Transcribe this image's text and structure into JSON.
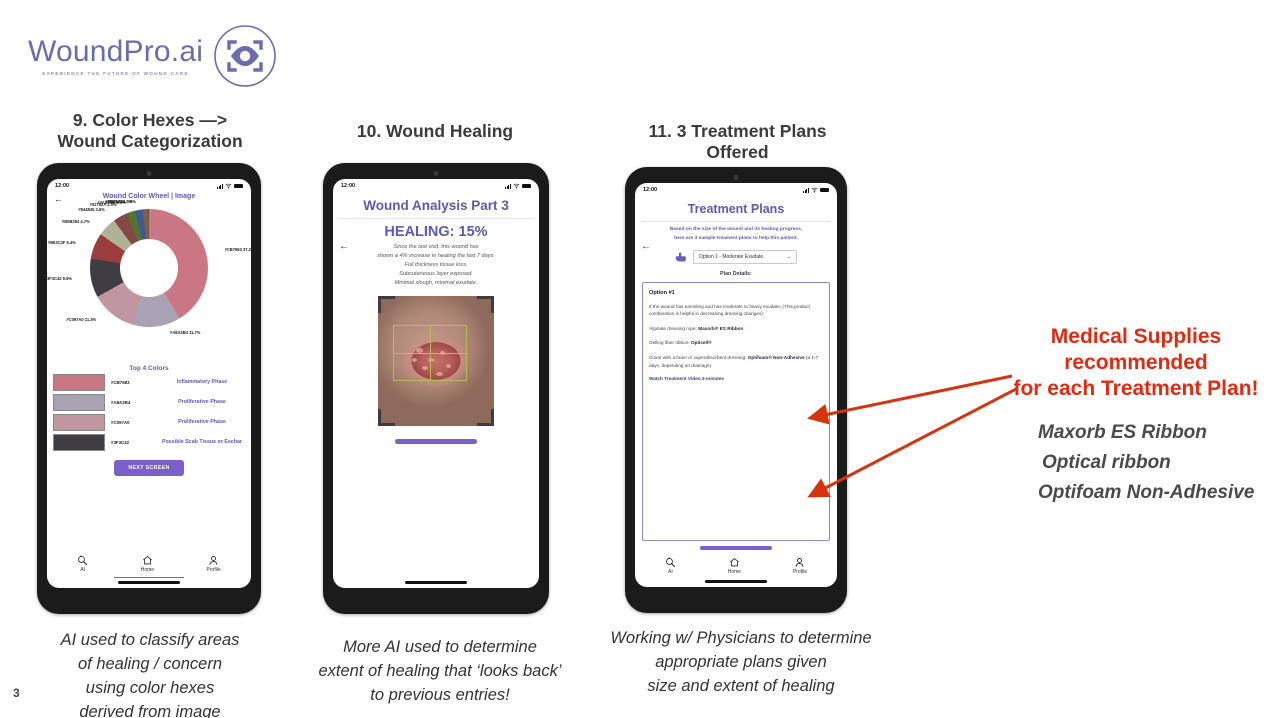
{
  "brand": {
    "name": "WoundPro.ai",
    "tagline": "EXPERIENCE THE FUTURE OF WOUND CARE",
    "logo_color": "#6b6bb0"
  },
  "sections": [
    {
      "title": "9. Color Hexes —>\nWound Categorization"
    },
    {
      "title": "10. Wound Healing"
    },
    {
      "title": "11. 3 Treatment Plans Offered"
    }
  ],
  "phone1": {
    "status": {
      "time": "12:00"
    },
    "app_title": "Wound Color Wheel | Image",
    "chart_title_top4": "Top 4 Colors",
    "next_button": "NEXT SCREEN",
    "nav": [
      {
        "label": "AI",
        "icon": "ai-search-icon"
      },
      {
        "label": "Home",
        "icon": "home-icon"
      },
      {
        "label": "Profile",
        "icon": "person-icon"
      }
    ],
    "top4": [
      {
        "hex": "#CB7683",
        "phase": "Inflammatory Phase"
      },
      {
        "hex": "#A8A2B4",
        "phase": "Proliferative Phase"
      },
      {
        "hex": "#C097A0",
        "phase": "Proliferative Phase"
      },
      {
        "hex": "#3F3C42",
        "phase": "Possible Scab Tissue or Eschar"
      }
    ]
  },
  "phone2": {
    "status": {
      "time": "12:00"
    },
    "title": "Wound Analysis Part 3",
    "healing_headline": "HEALING: 15%",
    "subtext": "Since the last visit, this wound has\nshown a 4% increase in healing the last 7 days.\nFull thickness tissue loss.\nSubcutaneous layer exposed.\nMinimal slough, minimal exudate."
  },
  "phone3": {
    "status": {
      "time": "12:00"
    },
    "title": "Treatment Plans",
    "description": "Based on the size of the wound and its healing progress,\nhere are 3 sample treament plans to help this patient.",
    "select_value": "Option 1 - Moderate Exudate",
    "plan_details_label": "Plan Details:",
    "plan": {
      "heading": "Option #1",
      "body": "If the wound has tunneling and has moderate to heavy exudate. (This product combination is helpful in decreasing dressing changes):",
      "line_alginate_prefix": "Alginate dressing rope: ",
      "line_alginate_product": "Maxorb® ES Ribbon",
      "line_gelling_prefix": "Gelling fiber ribbon: ",
      "line_gelling_product": "Opticell®",
      "line_cover_prefix": "Cover with a foam or superabsorbent dressing: ",
      "line_cover_product": "Optifoam® Non-Adhesive",
      "line_cover_suffix": " (a 1-7 days, depending on drainage)",
      "video_link": "Watch Treatment Video 3-minutes"
    },
    "nav": [
      {
        "label": "AI",
        "icon": "ai-search-icon"
      },
      {
        "label": "Home",
        "icon": "home-icon"
      },
      {
        "label": "Profile",
        "icon": "person-icon"
      }
    ]
  },
  "captions": [
    "AI used to classify areas\nof healing / concern\nusing color hexes\nderived from image",
    "More AI used to determine\nextent of healing that ‘looks back’\nto previous entries!",
    "Working w/ Physicians to determine\nappropriate plans given\nsize and extent of healing"
  ],
  "annotation": {
    "headline": "Medical Supplies\nrecommended\nfor each Treatment Plan!",
    "color": "#e02b12",
    "items": [
      "Maxorb ES Ribbon",
      "Optical ribbon",
      "Optifoam Non-Adhesive"
    ]
  },
  "page_number": "3",
  "chart_data": {
    "type": "pie",
    "title": "Wound Color Wheel | Image",
    "categories": [
      "#CB7683",
      "#A8A2B4",
      "#C097A0",
      "#3F3C42",
      "#9B3C3F",
      "#B0B294",
      "#844845",
      "#52752A",
      "#3A5C8E",
      "#885D40",
      "#6A5A55"
    ],
    "values": [
      37.2,
      11.7,
      11.3,
      9.6,
      6.4,
      4.7,
      3.6,
      2.0,
      2.0,
      1.0,
      0.5
    ],
    "labels": [
      "#CB7683 37.2%",
      "#A8A2B4 11.7%",
      "#C097A0 11.3%",
      "#3F3C42 9.6%",
      "#9B3C3F 6.4%",
      "#B0B294 4.7%",
      "#844845 3.6%",
      "#52752A 2.0%",
      "#3A5C8E 2.0%",
      "#885D40 1.0%",
      "#6A5A55 0.5%"
    ],
    "colors": [
      "#cb7683",
      "#a8a2b4",
      "#c097a0",
      "#3f3c42",
      "#9b3c3f",
      "#b0b294",
      "#844845",
      "#52752a",
      "#3a5c8e",
      "#885d40",
      "#6a5a55"
    ],
    "legend": "labels around donut",
    "donut": true
  }
}
